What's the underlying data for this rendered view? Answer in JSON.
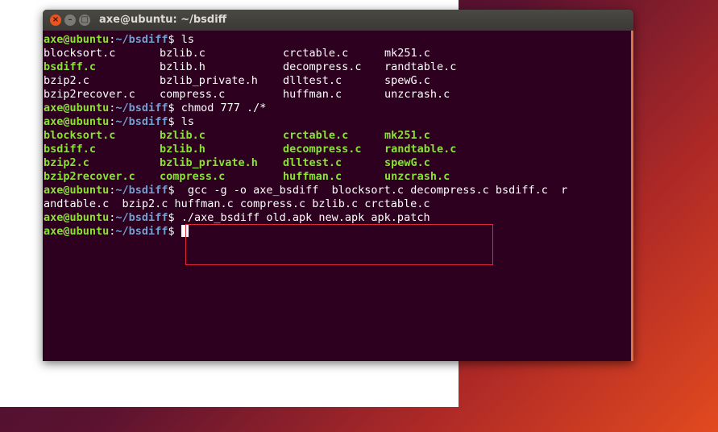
{
  "window": {
    "title": "axe@ubuntu: ~/bsdiff"
  },
  "prompt": {
    "user_host": "axe@ubuntu",
    "sep": ":",
    "path": "~/bsdiff",
    "symbol": "$"
  },
  "commands": {
    "c1": " ls",
    "c2": " chmod 777 ./*",
    "c3": " ls",
    "c4": "  gcc -g -o axe_bsdiff  blocksort.c decompress.c bsdiff.c  r",
    "c4_wrap": "andtable.c  bzip2.c huffman.c compress.c bzlib.c crctable.c",
    "c5": " ./axe_bsdiff old.apk new.apk apk.patch"
  },
  "listing1": [
    [
      "blocksort.c",
      "bzlib.c",
      "crctable.c",
      "mk251.c"
    ],
    [
      "bsdiff.c",
      "bzlib.h",
      "decompress.c",
      "randtable.c"
    ],
    [
      "bzip2.c",
      "bzlib_private.h",
      "dlltest.c",
      "spewG.c"
    ],
    [
      "bzip2recover.c",
      "compress.c",
      "huffman.c",
      "unzcrash.c"
    ]
  ],
  "listing2": [
    [
      "blocksort.c",
      "bzlib.c",
      "crctable.c",
      "mk251.c"
    ],
    [
      "bsdiff.c",
      "bzlib.h",
      "decompress.c",
      "randtable.c"
    ],
    [
      "bzip2.c",
      "bzlib_private.h",
      "dlltest.c",
      "spewG.c"
    ],
    [
      "bzip2recover.c",
      "compress.c",
      "huffman.c",
      "unzcrash.c"
    ]
  ],
  "colors": {
    "terminal_bg": "#2c001e",
    "prompt_green": "#8ae234",
    "prompt_blue": "#729fcf",
    "highlight_red": "#e0283b",
    "close_button": "#e95420"
  }
}
